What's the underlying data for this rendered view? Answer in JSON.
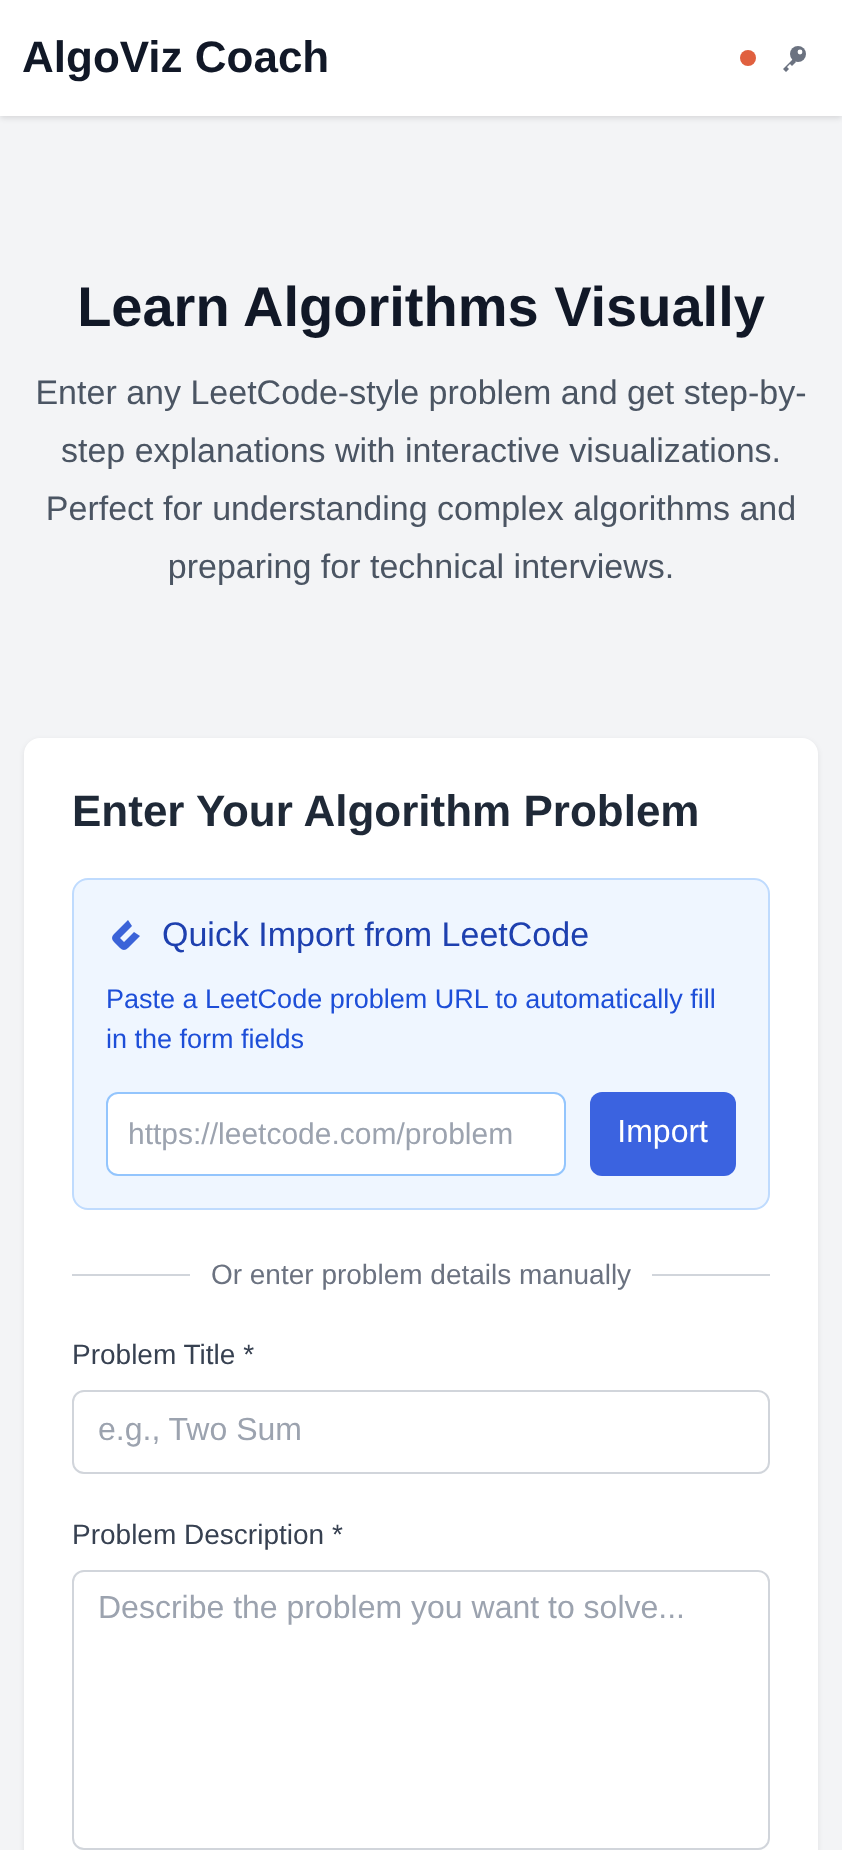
{
  "header": {
    "title": "AlgoViz Coach"
  },
  "hero": {
    "title": "Learn Algorithms Visually",
    "text": "Enter any LeetCode-style problem and get step-by-step explanations with interactive visualizations. Perfect for understanding complex algorithms and preparing for technical interviews."
  },
  "form": {
    "title": "Enter Your Algorithm Problem",
    "import": {
      "title": "Quick Import from LeetCode",
      "text": "Paste a LeetCode problem URL to automatically fill in the form fields",
      "placeholder": "https://leetcode.com/problem",
      "button": "Import"
    },
    "divider": "Or enter problem details manually",
    "fields": [
      {
        "kind": "input",
        "label": "Problem Title *",
        "placeholder": "e.g., Two Sum"
      },
      {
        "kind": "textarea",
        "label": "Problem Description *",
        "placeholder": "Describe the problem you want to solve..."
      }
    ]
  }
}
